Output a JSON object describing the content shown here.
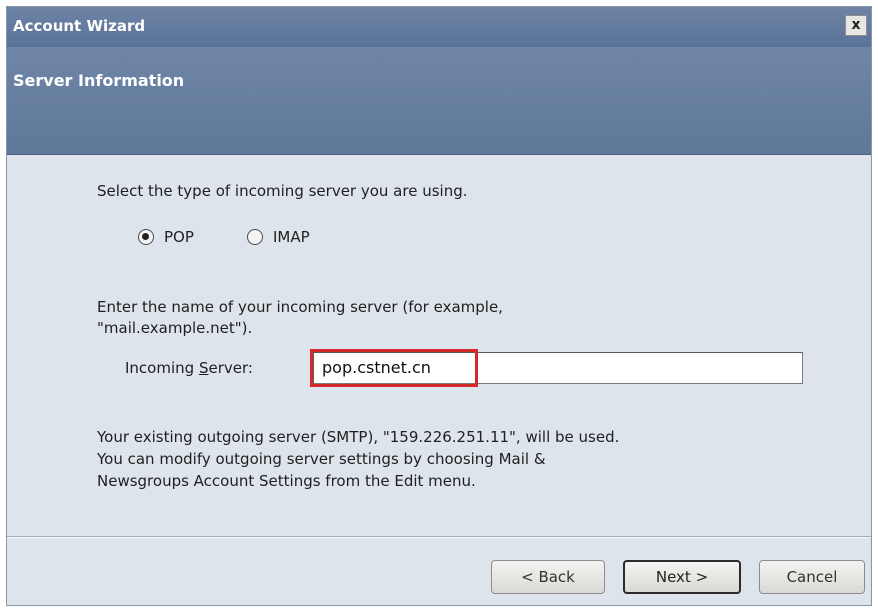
{
  "window": {
    "title": "Account Wizard",
    "close_label": "x"
  },
  "header": {
    "title": "Server Information"
  },
  "server_type": {
    "prompt": "Select the type of incoming server you are using.",
    "options": [
      {
        "label": "POP",
        "selected": true
      },
      {
        "label": "IMAP",
        "selected": false
      }
    ]
  },
  "incoming": {
    "prompt_line1": "Enter the name of your incoming server (for example,",
    "prompt_line2": "\"mail.example.net\").",
    "label_pre": "Incoming ",
    "label_accel": "S",
    "label_post": "erver:",
    "value": "pop.cstnet.cn"
  },
  "outgoing_note": {
    "line1": "Your existing outgoing server (SMTP), \"159.226.251.11\", will be used.",
    "line2": "You can modify outgoing server settings by choosing Mail &",
    "line3": "Newsgroups Account Settings from the Edit menu."
  },
  "buttons": {
    "back": "< Back",
    "next": "Next >",
    "cancel": "Cancel"
  },
  "colors": {
    "header_bg": "#6f86a8",
    "dialog_bg": "#dee4ec",
    "highlight": "#d42a2a"
  }
}
